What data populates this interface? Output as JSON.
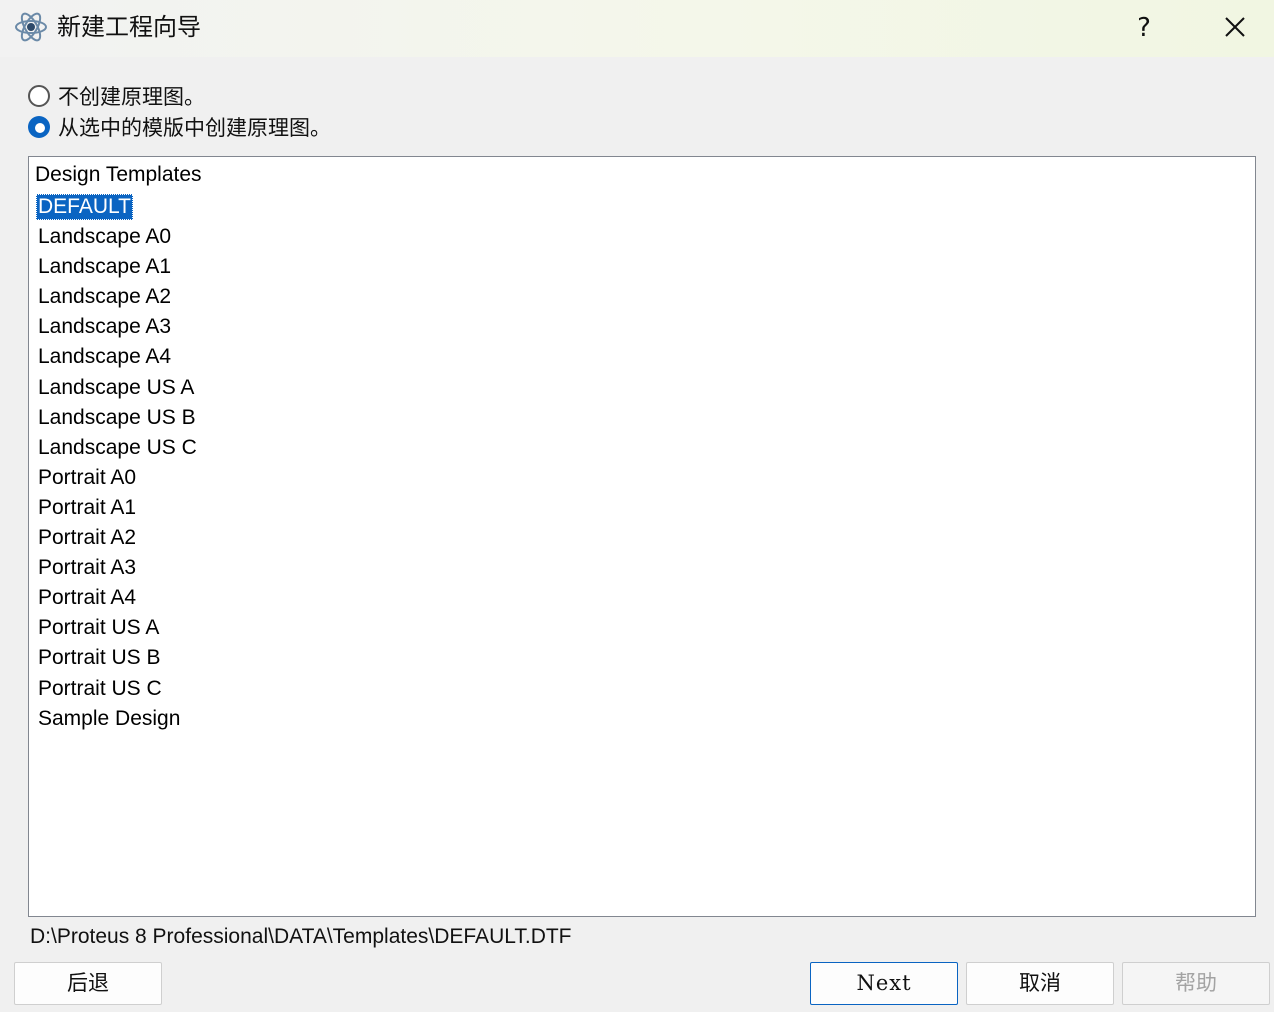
{
  "window": {
    "title": "新建工程向导",
    "help_label": "?",
    "close_icon": "close-icon",
    "app_icon": "proteus-atom-icon"
  },
  "options": [
    {
      "label": "不创建原理图。",
      "checked": false
    },
    {
      "label": "从选中的模版中创建原理图。",
      "checked": true
    }
  ],
  "templates": {
    "header": "Design Templates",
    "items": [
      "DEFAULT",
      "Landscape A0",
      "Landscape A1",
      "Landscape A2",
      "Landscape A3",
      "Landscape A4",
      "Landscape US A",
      "Landscape US B",
      "Landscape US C",
      "Portrait A0",
      "Portrait A1",
      "Portrait A2",
      "Portrait A3",
      "Portrait A4",
      "Portrait US A",
      "Portrait US B",
      "Portrait US C",
      "Sample Design"
    ],
    "selected": "DEFAULT"
  },
  "path": "D:\\Proteus 8 Professional\\DATA\\Templates\\DEFAULT.DTF",
  "buttons": {
    "back": "后退",
    "next": "Next",
    "cancel": "取消",
    "help": "帮助"
  },
  "colors": {
    "accent": "#0a64c2",
    "disabled_text": "#a3a3a3"
  }
}
